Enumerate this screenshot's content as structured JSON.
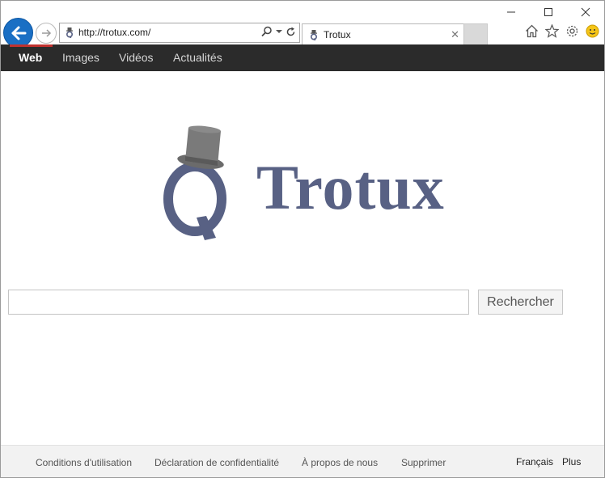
{
  "browser": {
    "address": "http://trotux.com/",
    "tab_title": "Trotux",
    "tab_close": "✕",
    "window_buttons": {
      "minimize": "—",
      "maximize": "☐",
      "close": "✕"
    }
  },
  "nav": {
    "items": [
      {
        "label": "Web",
        "active": true
      },
      {
        "label": "Images",
        "active": false
      },
      {
        "label": "Vidéos",
        "active": false
      },
      {
        "label": "Actualités",
        "active": false
      }
    ]
  },
  "logo": {
    "text": "Trotux"
  },
  "search": {
    "value": "",
    "button_label": "Rechercher"
  },
  "footer": {
    "links": [
      "Conditions d'utilisation",
      "Déclaration de confidentialité",
      "À propos de nous",
      "Supprimer"
    ],
    "language": "Français",
    "more": "Plus"
  },
  "colors": {
    "nav_bg": "#2b2b2b",
    "nav_active_underline": "#c0322f",
    "logo": "#586184",
    "back_button": "#1a6fc4"
  }
}
